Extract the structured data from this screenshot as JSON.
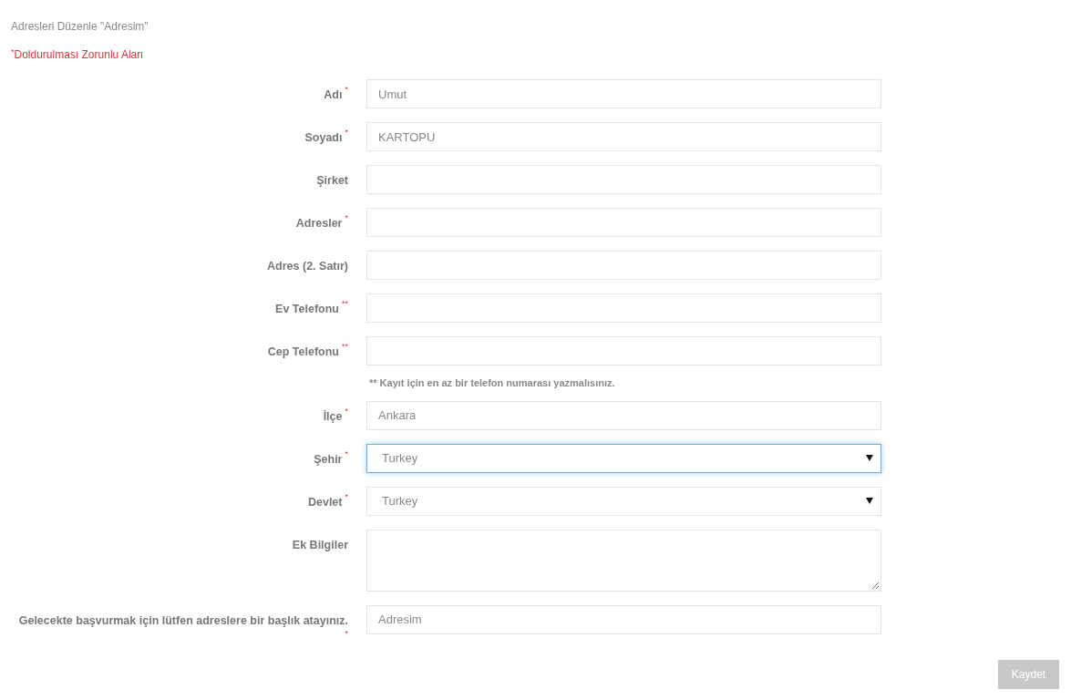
{
  "title": "Adresleri Düzenle \"Adresim\"",
  "required_note": {
    "mark": "*",
    "text": "Doldurulması Zorunlu Alan"
  },
  "fields": [
    {
      "kind": "text",
      "label": "Adı",
      "mark": "*",
      "value": "Umut",
      "focused": false
    },
    {
      "kind": "text",
      "label": "Soyadı",
      "mark": "*",
      "value": "KARTOPU",
      "focused": false
    },
    {
      "kind": "text",
      "label": "Şirket",
      "focused": false
    },
    {
      "kind": "text",
      "label": "Adresler",
      "mark": "*",
      "focused": false
    },
    {
      "kind": "text",
      "label": "Adres (2. Satır)",
      "focused": false
    },
    {
      "kind": "text",
      "label": "Ev Telefonu",
      "mark": "**",
      "focused": false
    },
    {
      "kind": "text",
      "label": "Cep Telefonu",
      "mark": "**",
      "focused": false
    },
    {
      "kind": "note",
      "text": "** Kayıt için en az bir telefon numarası yazmalısınız."
    },
    {
      "kind": "text",
      "label": "İlçe",
      "mark": "*",
      "value": "Ankara",
      "focused": false
    },
    {
      "kind": "select",
      "label": "Şehir",
      "mark": "*",
      "value": "Turkey",
      "focused": true
    },
    {
      "kind": "select",
      "label": "Devlet",
      "mark": "*",
      "value": "Turkey",
      "focused": false
    },
    {
      "kind": "textarea",
      "label": "Ek Bilgiler",
      "focused": false
    },
    {
      "kind": "text",
      "label": "Gelecekte başvurmak için lütfen adreslere bir başlık atayınız.",
      "mark": "*",
      "mark_below": true,
      "value": "Adresim",
      "focused": false
    }
  ],
  "save_button": {
    "label": "Kaydet",
    "disabled": true
  }
}
